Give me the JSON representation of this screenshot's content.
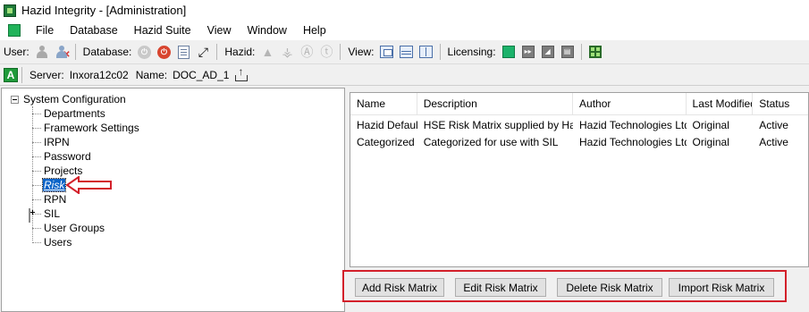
{
  "window": {
    "title": "Hazid Integrity - [Administration]",
    "app_icon": "hazid-app-icon"
  },
  "menubar": {
    "items": [
      "File",
      "Database",
      "Hazid Suite",
      "View",
      "Window",
      "Help"
    ]
  },
  "toolbar": {
    "user_label": "User:",
    "database_label": "Database:",
    "hazid_label": "Hazid:",
    "view_label": "View:",
    "licensing_label": "Licensing:"
  },
  "serverbar": {
    "status_badge": "A",
    "server_label": "Server:",
    "server_value": "Inxora12c02",
    "name_label": "Name:",
    "name_value": "DOC_AD_1"
  },
  "tree": {
    "root": "System Configuration",
    "items": [
      "Departments",
      "Framework Settings",
      "IRPN",
      "Password",
      "Projects",
      "Risk",
      "RPN",
      "SIL",
      "User Groups",
      "Users"
    ],
    "selected": "Risk"
  },
  "list": {
    "columns": [
      "Name",
      "Description",
      "Author",
      "Last Modified",
      "Status"
    ],
    "rows": [
      [
        "Hazid Default",
        "HSE Risk Matrix supplied by Hazid",
        "Hazid Technologies Ltd.",
        "Original",
        "Active"
      ],
      [
        "Categorized",
        "Categorized for use with SIL",
        "Hazid Technologies Ltd.",
        "Original",
        "Active"
      ]
    ]
  },
  "actions": {
    "add": "Add Risk Matrix",
    "edit": "Edit Risk Matrix",
    "delete": "Delete Risk Matrix",
    "import": "Import Risk Matrix"
  },
  "colors": {
    "annotation_red": "#d3202a",
    "selection_blue": "#0a64c8",
    "status_green": "#1f9a3a"
  }
}
